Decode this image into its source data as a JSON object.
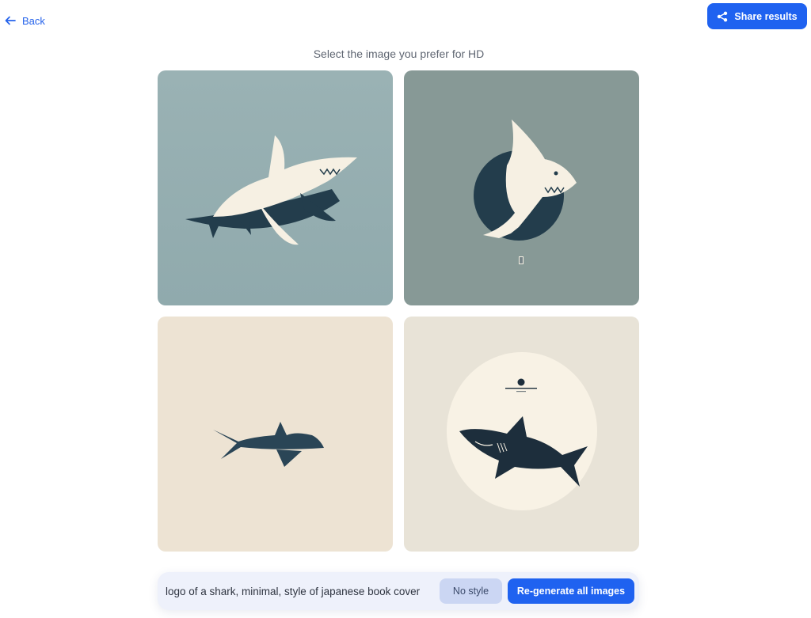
{
  "header": {
    "back_label": "Back",
    "share_label": "Share results"
  },
  "main": {
    "subtitle": "Select the image you prefer for HD",
    "images": [
      {
        "name": "shark-image-1",
        "background": "#95aeb0"
      },
      {
        "name": "shark-image-2",
        "background": "#879996"
      },
      {
        "name": "shark-image-3",
        "background": "#ede3d3"
      },
      {
        "name": "shark-image-4",
        "background": "#e8e3d7"
      }
    ]
  },
  "prompt_bar": {
    "prompt_value": "logo of a shark, minimal, style of japanese book cover",
    "style_button_label": "No style",
    "regenerate_label": "Re-generate all images"
  },
  "colors": {
    "accent": "#1f62f0",
    "shark_dark": "#233d4c",
    "shark_light": "#f6f0e3"
  },
  "icons": [
    "arrow-left-icon",
    "share-icon"
  ]
}
